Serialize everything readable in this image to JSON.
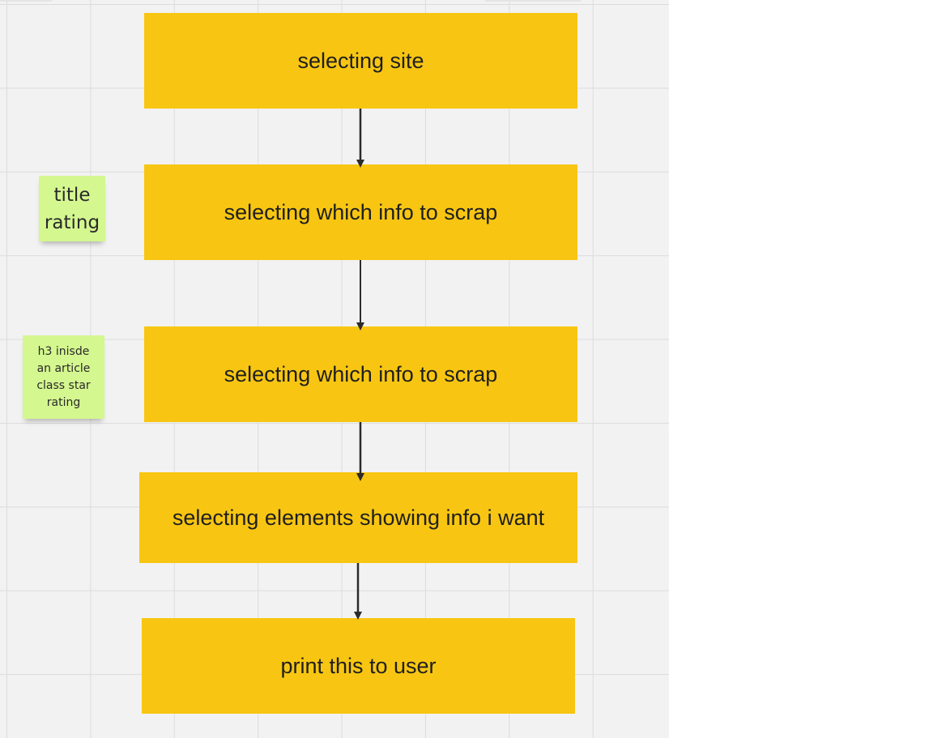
{
  "nodes": [
    {
      "label": "selecting site"
    },
    {
      "label": "selecting which info to scrap"
    },
    {
      "label": "selecting which info to scrap"
    },
    {
      "label": "selecting elements showing info i want"
    },
    {
      "label": "print this to user"
    }
  ],
  "stickies": [
    {
      "text": "title\nrating"
    },
    {
      "text": "h3 inisde\nan article\nclass star\nrating"
    }
  ],
  "colors": {
    "node_fill": "#f8c612",
    "sticky_fill": "#d4f78f",
    "arrow": "#2b2b2b",
    "canvas": "#f2f2f2",
    "grid": "#dcdcdc"
  }
}
